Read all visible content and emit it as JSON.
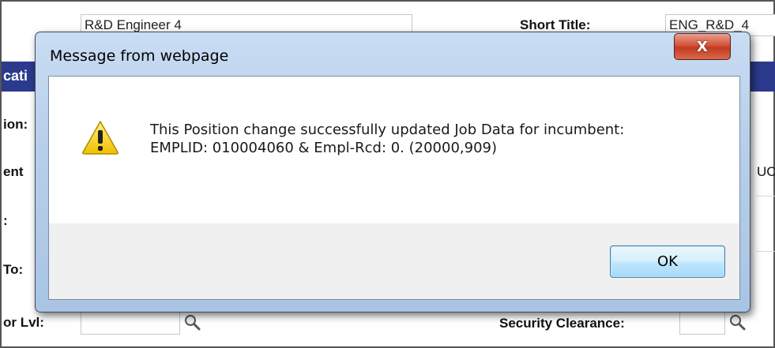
{
  "background": {
    "description_field": "R&D Engineer 4",
    "short_title_label": "Short Title:",
    "short_title_value": "ENG_R&D_4",
    "section_header": "cati",
    "row_labels": [
      "ion:",
      "ent",
      ":",
      "To:",
      "or Lvl:"
    ],
    "right_partial_value": "UC",
    "security_clearance_label": "Security Clearance:"
  },
  "dialog": {
    "title": "Message from webpage",
    "close_label": "X",
    "message_line1": "This Position change successfully updated Job Data for incumbent:",
    "message_line2": "EMPLID: 010004060 & Empl-Rcd: 0. (20000,909)",
    "ok_label": "OK"
  },
  "icons": [
    "warning-icon",
    "lookup-icon",
    "close-icon"
  ],
  "colors": {
    "header_bar": "#2b3a8c",
    "dialog_frame": "#b7cfea",
    "close_button": "#c23a22",
    "ok_button": "#bee6fd",
    "warning_yellow": "#f5d000"
  }
}
